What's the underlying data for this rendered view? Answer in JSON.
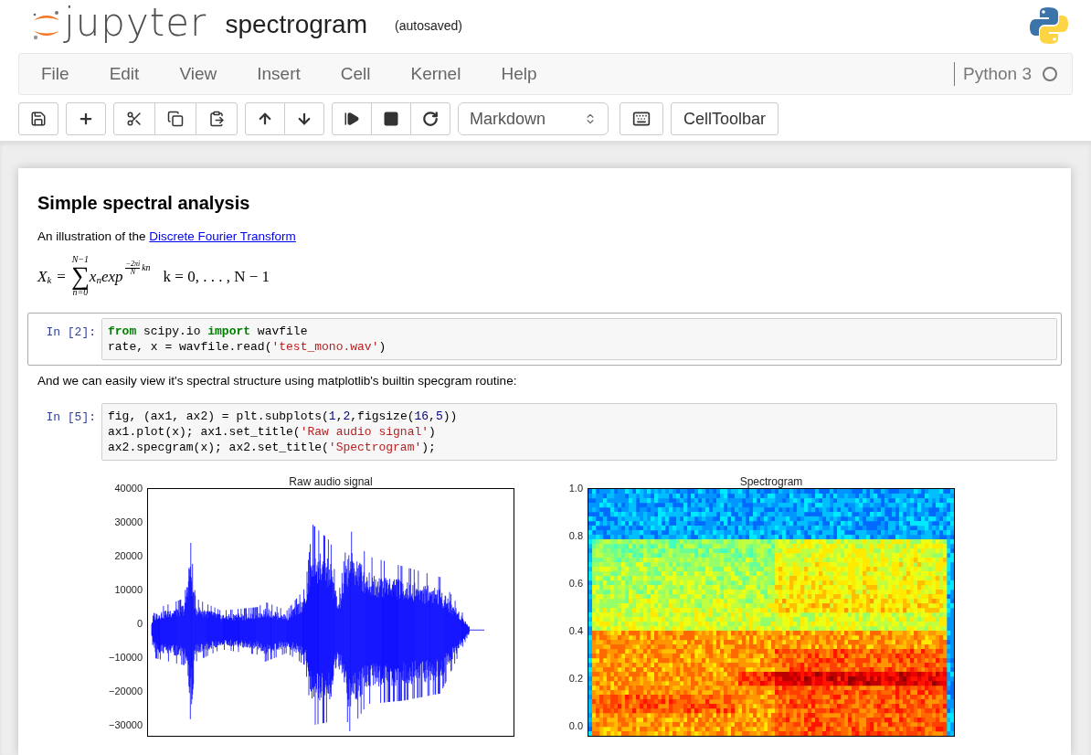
{
  "header": {
    "logo_text": "jupyter",
    "notebook_name": "spectrogram",
    "save_status": "(autosaved)"
  },
  "menu": [
    {
      "label": "File"
    },
    {
      "label": "Edit"
    },
    {
      "label": "View"
    },
    {
      "label": "Insert"
    },
    {
      "label": "Cell"
    },
    {
      "label": "Kernel"
    },
    {
      "label": "Help"
    }
  ],
  "kernel": {
    "name": "Python 3"
  },
  "toolbar": {
    "cell_type": "Markdown",
    "cell_toolbar": "CellToolbar"
  },
  "cells": [
    {
      "kind": "markdown",
      "heading": "Simple spectral analysis",
      "paragraph": "An illustration of the ",
      "link": "Discrete Fourier Transform",
      "formula": {
        "lhs": "X",
        "lhs_sub": "k",
        "eq": "=",
        "sum_top": "N−1",
        "sum": "∑",
        "sum_bottom": "n=0",
        "body": "x",
        "body_sub": "n",
        "func": "exp",
        "exp_num": "−2πi",
        "exp_den": "N",
        "exp_tail": "kn",
        "range": "k = 0, . . . , N − 1"
      }
    },
    {
      "kind": "code",
      "selected": true,
      "prompt": "In [2]:",
      "lines": [
        [
          {
            "kind": "keyword",
            "s": "from"
          },
          {
            "kind": "plain",
            "s": " scipy.io "
          },
          {
            "kind": "keyword",
            "s": "import"
          },
          {
            "kind": "plain",
            "s": " wavfile"
          }
        ],
        [
          {
            "kind": "plain",
            "s": "rate, x = wavfile.read("
          },
          {
            "kind": "string",
            "s": "'test_mono.wav'"
          },
          {
            "kind": "plain",
            "s": ")"
          }
        ]
      ]
    },
    {
      "kind": "markdown",
      "paragraph": "And we can easily view it's spectral structure using matplotlib's builtin specgram routine:"
    },
    {
      "kind": "code",
      "selected": false,
      "prompt": "In [5]:",
      "lines": [
        [
          {
            "kind": "plain",
            "s": "fig, (ax1, ax2) = plt.subplots("
          },
          {
            "kind": "number",
            "s": "1"
          },
          {
            "kind": "plain",
            "s": ","
          },
          {
            "kind": "number",
            "s": "2"
          },
          {
            "kind": "plain",
            "s": ",figsize("
          },
          {
            "kind": "number",
            "s": "16"
          },
          {
            "kind": "plain",
            "s": ","
          },
          {
            "kind": "number",
            "s": "5"
          },
          {
            "kind": "plain",
            "s": "))"
          }
        ],
        [
          {
            "kind": "plain",
            "s": "ax1.plot(x); ax1.set_title("
          },
          {
            "kind": "string",
            "s": "'Raw audio signal'"
          },
          {
            "kind": "plain",
            "s": ")"
          }
        ],
        [
          {
            "kind": "plain",
            "s": "ax2.specgram(x); ax2.set_title("
          },
          {
            "kind": "string",
            "s": "'Spectrogram'"
          },
          {
            "kind": "plain",
            "s": ");"
          }
        ]
      ],
      "outputs": [
        {
          "kind": "waveform",
          "title": "Raw audio signal",
          "yticks": [
            "40000",
            "30000",
            "20000",
            "10000",
            "0",
            "−10000",
            "−20000",
            "−30000"
          ]
        },
        {
          "kind": "spectrogram",
          "title": "Spectrogram",
          "yticks": [
            "1.0",
            "0.8",
            "0.6",
            "0.4",
            "0.2",
            "0.0"
          ]
        }
      ]
    }
  ]
}
